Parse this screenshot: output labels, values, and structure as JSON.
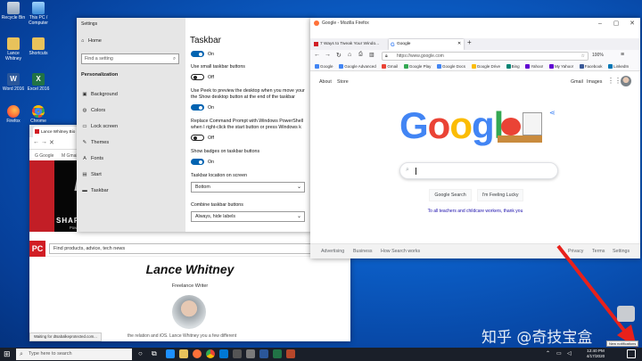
{
  "colors": {
    "win_blue": "#0063b1",
    "google_blue": "#4285f4",
    "google_red": "#ea4335",
    "google_yellow": "#fbbc05",
    "google_green": "#34a853",
    "taskbar": "#1a1f29",
    "pc_red": "#d11d24"
  },
  "desktop_icons": [
    {
      "label": "Recycle Bin",
      "icon": "recycle-bin-icon"
    },
    {
      "label": "This PC / Computer",
      "icon": "this-pc-icon"
    },
    {
      "label": "Lance Whitney",
      "icon": "folder-icon"
    },
    {
      "label": "Shortcuts",
      "icon": "folder-icon"
    },
    {
      "label": "Word 2016",
      "icon": "word-icon"
    },
    {
      "label": "Excel 2016",
      "icon": "excel-icon"
    },
    {
      "label": "Firefox",
      "icon": "firefox-icon"
    },
    {
      "label": "Chrome",
      "icon": "chrome-icon"
    }
  ],
  "settings": {
    "title": "Settings",
    "home": "Home",
    "search_placeholder": "Find a setting",
    "section": "Personalization",
    "nav": [
      "Background",
      "Colors",
      "Lock screen",
      "Themes",
      "Fonts",
      "Start",
      "Taskbar"
    ],
    "page_title": "Taskbar",
    "on": "On",
    "off": "Off",
    "s1": "Use small taskbar buttons",
    "s2a": "Use Peek to preview the desktop when you move your",
    "s2b": "the Show desktop button at the end of the taskbar",
    "s3a": "Replace Command Prompt with Windows PowerShell",
    "s3b": "when I right-click the start button or press Windows k",
    "s4": "Show badges on taskbar buttons",
    "location_label": "Taskbar location on screen",
    "location_value": "Bottom",
    "combine_label": "Combine taskbar buttons",
    "combine_value": "Always, hide labels"
  },
  "chrome": {
    "tab": "Lance Whitney Bio",
    "banner": "SHARPER IN CORE BLACK",
    "banner_sub": "Powered by 10th Gen. Intel® Core™ i7 processor",
    "brand_logo": "msi",
    "pc_logo": "PC",
    "search_placeholder": "Find products, advice, tech news",
    "name": "Lance Whitney",
    "role": "Freelance Writer",
    "status": "Waiting for dtsabalkeprotected.com...",
    "body": "the relation and iOS. Lance Whitney you a few different"
  },
  "firefox": {
    "title": "Google - Mozilla Firefox",
    "tabs": [
      "7 Ways to Tweak Your Windo...",
      "Google"
    ],
    "url": "https://www.google.com",
    "zoom": "100%",
    "bookmarks": [
      {
        "label": "Google",
        "color": "#4285f4"
      },
      {
        "label": "Google Advanced",
        "color": "#4285f4"
      },
      {
        "label": "Gmail",
        "color": "#ea4335"
      },
      {
        "label": "Google Play",
        "color": "#34a853"
      },
      {
        "label": "Google Docs",
        "color": "#4285f4"
      },
      {
        "label": "Google Drive",
        "color": "#fbbc05"
      },
      {
        "label": "Bing",
        "color": "#008373"
      },
      {
        "label": "Yahoo!",
        "color": "#6001d2"
      },
      {
        "label": "My Yahoo!",
        "color": "#6001d2"
      },
      {
        "label": "Facebook",
        "color": "#3b5998"
      },
      {
        "label": "LinkedIn",
        "color": "#0077b5"
      }
    ],
    "top_links": [
      "About",
      "Store"
    ],
    "top_right": [
      "Gmail",
      "Images"
    ],
    "logo_letters": [
      "G",
      "o",
      "o",
      "g",
      "l"
    ],
    "btn_search": "Google Search",
    "btn_lucky": "I'm Feeling Lucky",
    "message": "To all teachers and childcare workers, thank you",
    "footer_left": [
      "Advertising",
      "Business",
      "How Search works"
    ],
    "footer_right": [
      "Privacy",
      "Terms",
      "Settings"
    ]
  },
  "taskbar": {
    "search_placeholder": "Type here to search",
    "time": "12:40 PM",
    "date": "4/17/2020",
    "tooltip": "New notifications"
  },
  "watermark": "知乎 @奇技宝盒"
}
